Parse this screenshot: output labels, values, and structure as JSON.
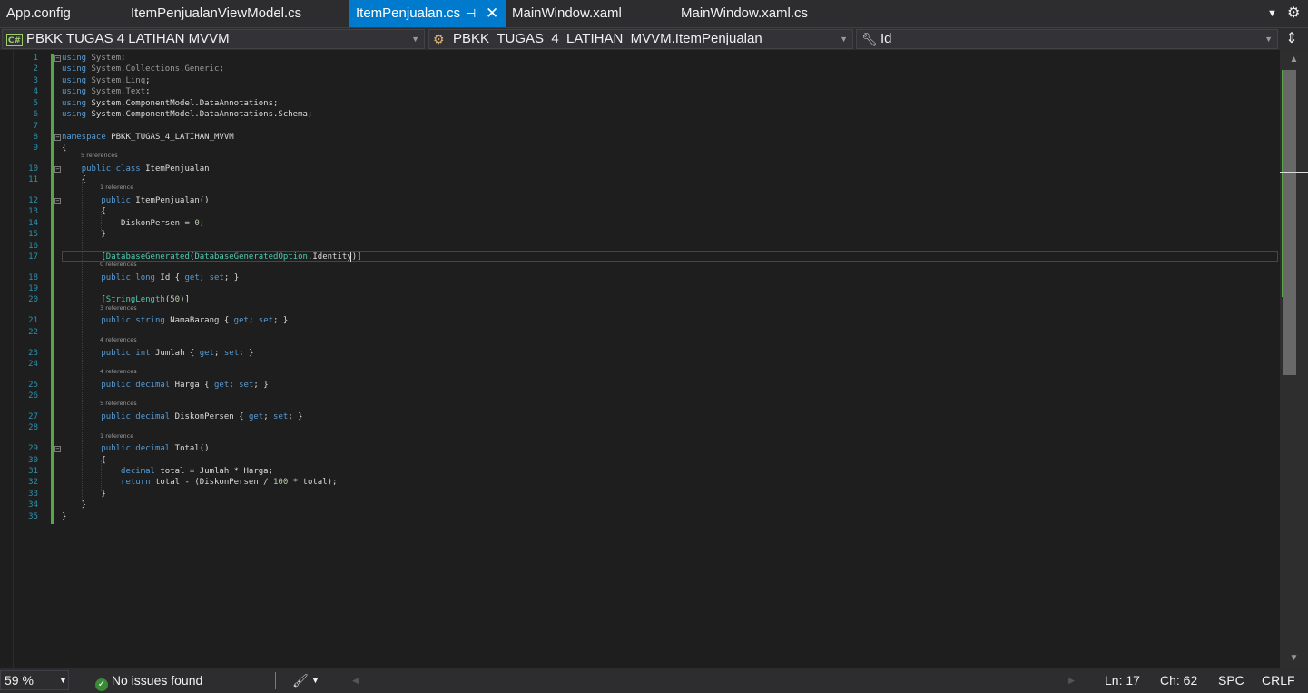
{
  "tabs": [
    {
      "label": "App.config",
      "active": false
    },
    {
      "label": "ItemPenjualanViewModel.cs",
      "active": false
    },
    {
      "label": "ItemPenjualan.cs",
      "active": true
    },
    {
      "label": "MainWindow.xaml",
      "active": false
    },
    {
      "label": "MainWindow.xaml.cs",
      "active": false
    }
  ],
  "tab_icons": {
    "pin": "pin-icon",
    "close": "close-icon",
    "overflow": "chevron-down-icon",
    "settings": "gear-icon"
  },
  "navbar": {
    "project": "PBKK TUGAS 4 LATIHAN MVVM",
    "project_badge": "C#",
    "type": "PBKK_TUGAS_4_LATIHAN_MVVM.ItemPenjualan",
    "member": "Id"
  },
  "editor": {
    "lines": [
      {
        "n": "1",
        "text": "using System;"
      },
      {
        "n": "2",
        "text": "using System.Collections.Generic;"
      },
      {
        "n": "3",
        "text": "using System.Linq;"
      },
      {
        "n": "4",
        "text": "using System.Text;"
      },
      {
        "n": "5",
        "text": "using System.ComponentModel.DataAnnotations;"
      },
      {
        "n": "6",
        "text": "using System.ComponentModel.DataAnnotations.Schema;"
      },
      {
        "n": "7",
        "text": ""
      },
      {
        "n": "8",
        "text": "namespace PBKK_TUGAS_4_LATIHAN_MVVM"
      },
      {
        "n": "9",
        "text": "{"
      },
      {
        "n": "10",
        "text": "    public class ItemPenjualan"
      },
      {
        "n": "11",
        "text": "    {"
      },
      {
        "n": "12",
        "text": "        public ItemPenjualan()"
      },
      {
        "n": "13",
        "text": "        {"
      },
      {
        "n": "14",
        "text": "            DiskonPersen = 0;"
      },
      {
        "n": "15",
        "text": "        }"
      },
      {
        "n": "16",
        "text": ""
      },
      {
        "n": "17",
        "text": "        [DatabaseGenerated(DatabaseGeneratedOption.Identity)]"
      },
      {
        "n": "18",
        "text": "        public long Id { get; set; }"
      },
      {
        "n": "19",
        "text": ""
      },
      {
        "n": "20",
        "text": "        [StringLength(50)]"
      },
      {
        "n": "21",
        "text": "        public string NamaBarang { get; set; }"
      },
      {
        "n": "22",
        "text": ""
      },
      {
        "n": "23",
        "text": "        public int Jumlah { get; set; }"
      },
      {
        "n": "24",
        "text": ""
      },
      {
        "n": "25",
        "text": "        public decimal Harga { get; set; }"
      },
      {
        "n": "26",
        "text": ""
      },
      {
        "n": "27",
        "text": "        public decimal DiskonPersen { get; set; }"
      },
      {
        "n": "28",
        "text": ""
      },
      {
        "n": "29",
        "text": "        public decimal Total()"
      },
      {
        "n": "30",
        "text": "        {"
      },
      {
        "n": "31",
        "text": "            decimal total = Jumlah * Harga;"
      },
      {
        "n": "32",
        "text": "            return total - (DiskonPersen / 100 * total);"
      },
      {
        "n": "33",
        "text": "        }"
      },
      {
        "n": "34",
        "text": "    }"
      },
      {
        "n": "35",
        "text": "}"
      }
    ],
    "codelens": [
      {
        "before_line": "10",
        "text": "5 references"
      },
      {
        "before_line": "12",
        "text": "1 reference"
      },
      {
        "before_line": "18",
        "text": "0 references"
      },
      {
        "before_line": "21",
        "text": "3 references"
      },
      {
        "before_line": "23",
        "text": "4 references"
      },
      {
        "before_line": "25",
        "text": "4 references"
      },
      {
        "before_line": "27",
        "text": "5 references"
      },
      {
        "before_line": "29",
        "text": "1 reference"
      }
    ]
  },
  "statusbar": {
    "zoom": "59 %",
    "issues": "No issues found",
    "position_line": "Ln: 17",
    "position_char": "Ch: 62",
    "indent": "SPC",
    "line_ending": "CRLF"
  },
  "colors": {
    "accent": "#007acc",
    "keyword": "#569cd6",
    "type": "#4ec9b0",
    "number": "#b5cea8",
    "line_number": "#2b91af",
    "change_bar": "#57a64a"
  }
}
